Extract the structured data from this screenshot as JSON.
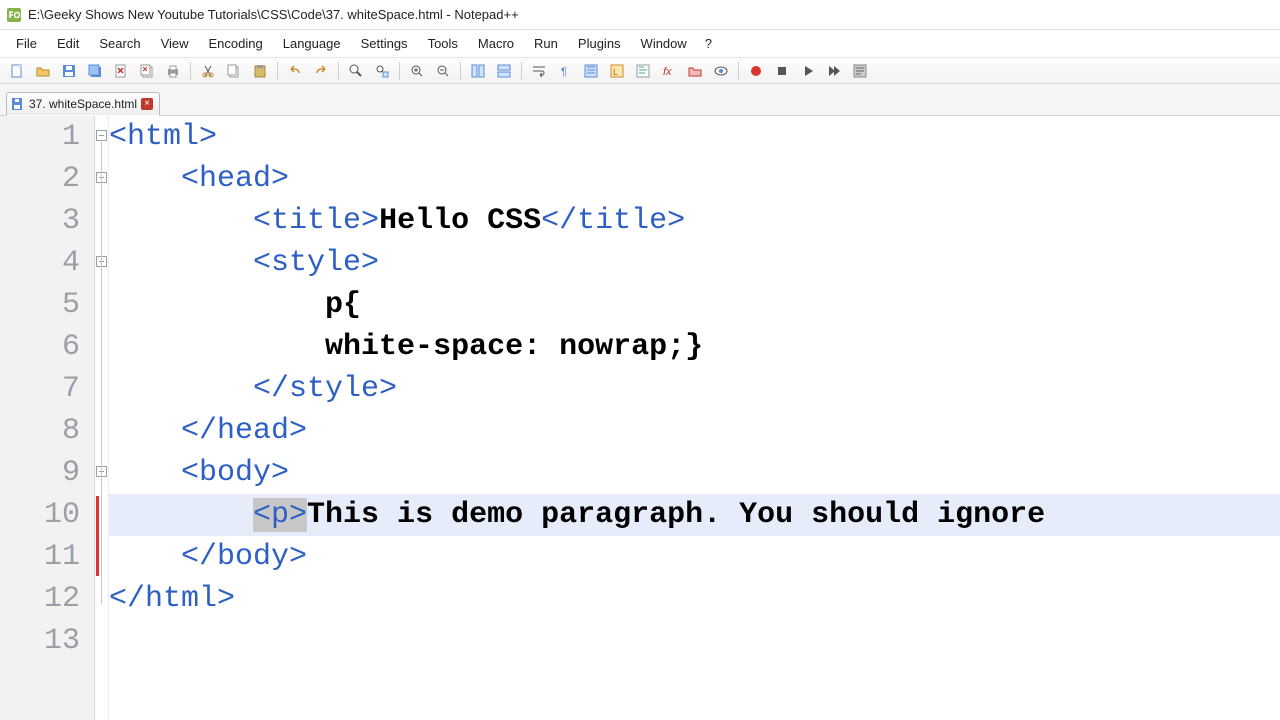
{
  "title": "E:\\Geeky Shows New Youtube Tutorials\\CSS\\Code\\37. whiteSpace.html - Notepad++",
  "menus": [
    "File",
    "Edit",
    "Search",
    "View",
    "Encoding",
    "Language",
    "Settings",
    "Tools",
    "Macro",
    "Run",
    "Plugins",
    "Window",
    "?"
  ],
  "tab": {
    "label": "37. whiteSpace.html"
  },
  "toolbar_icons": [
    "new-file",
    "open-file",
    "save",
    "copy-file",
    "paste-file",
    "save-all",
    "print",
    "sep",
    "cut",
    "copy",
    "paste",
    "sep",
    "undo",
    "redo",
    "sep",
    "find",
    "find-in-files",
    "sep",
    "zoom-in",
    "zoom-out",
    "sep",
    "sync-v",
    "sync-h",
    "sep",
    "wrap",
    "show-symbol",
    "indent-guide",
    "lang-user",
    "fold-all",
    "unfold-all",
    "folder",
    "eye",
    "sep",
    "record",
    "stop",
    "play",
    "play-fast",
    "macro-list"
  ],
  "linecount": 13,
  "highlight_line": 10,
  "fold_markers": [
    1,
    2,
    4,
    9
  ],
  "code": {
    "l1": {
      "indent": "",
      "open": "<html>",
      "text": "",
      "close": ""
    },
    "l2": {
      "indent": "    ",
      "open": "<head>",
      "text": "",
      "close": ""
    },
    "l3": {
      "indent": "        ",
      "open": "<title>",
      "text": "Hello CSS",
      "close": "</title>"
    },
    "l4": {
      "indent": "        ",
      "open": "<style>",
      "text": "",
      "close": ""
    },
    "l5": {
      "indent": "            ",
      "open": "",
      "text": "p{",
      "close": ""
    },
    "l6": {
      "indent": "            ",
      "open": "",
      "text": "white-space: nowrap;}",
      "close": ""
    },
    "l7": {
      "indent": "        ",
      "open": "</style>",
      "text": "",
      "close": ""
    },
    "l8": {
      "indent": "    ",
      "open": "</head>",
      "text": "",
      "close": ""
    },
    "l9": {
      "indent": "    ",
      "open": "<body>",
      "text": "",
      "close": ""
    },
    "l10": {
      "indent": "        ",
      "open": "<p>",
      "text": "This is demo paragraph. You should ignore ",
      "close": ""
    },
    "l11": {
      "indent": "    ",
      "open": "</body>",
      "text": "",
      "close": ""
    },
    "l12": {
      "indent": "",
      "open": "</html>",
      "text": "",
      "close": ""
    },
    "l13": {
      "indent": "",
      "open": "",
      "text": "",
      "close": ""
    }
  }
}
